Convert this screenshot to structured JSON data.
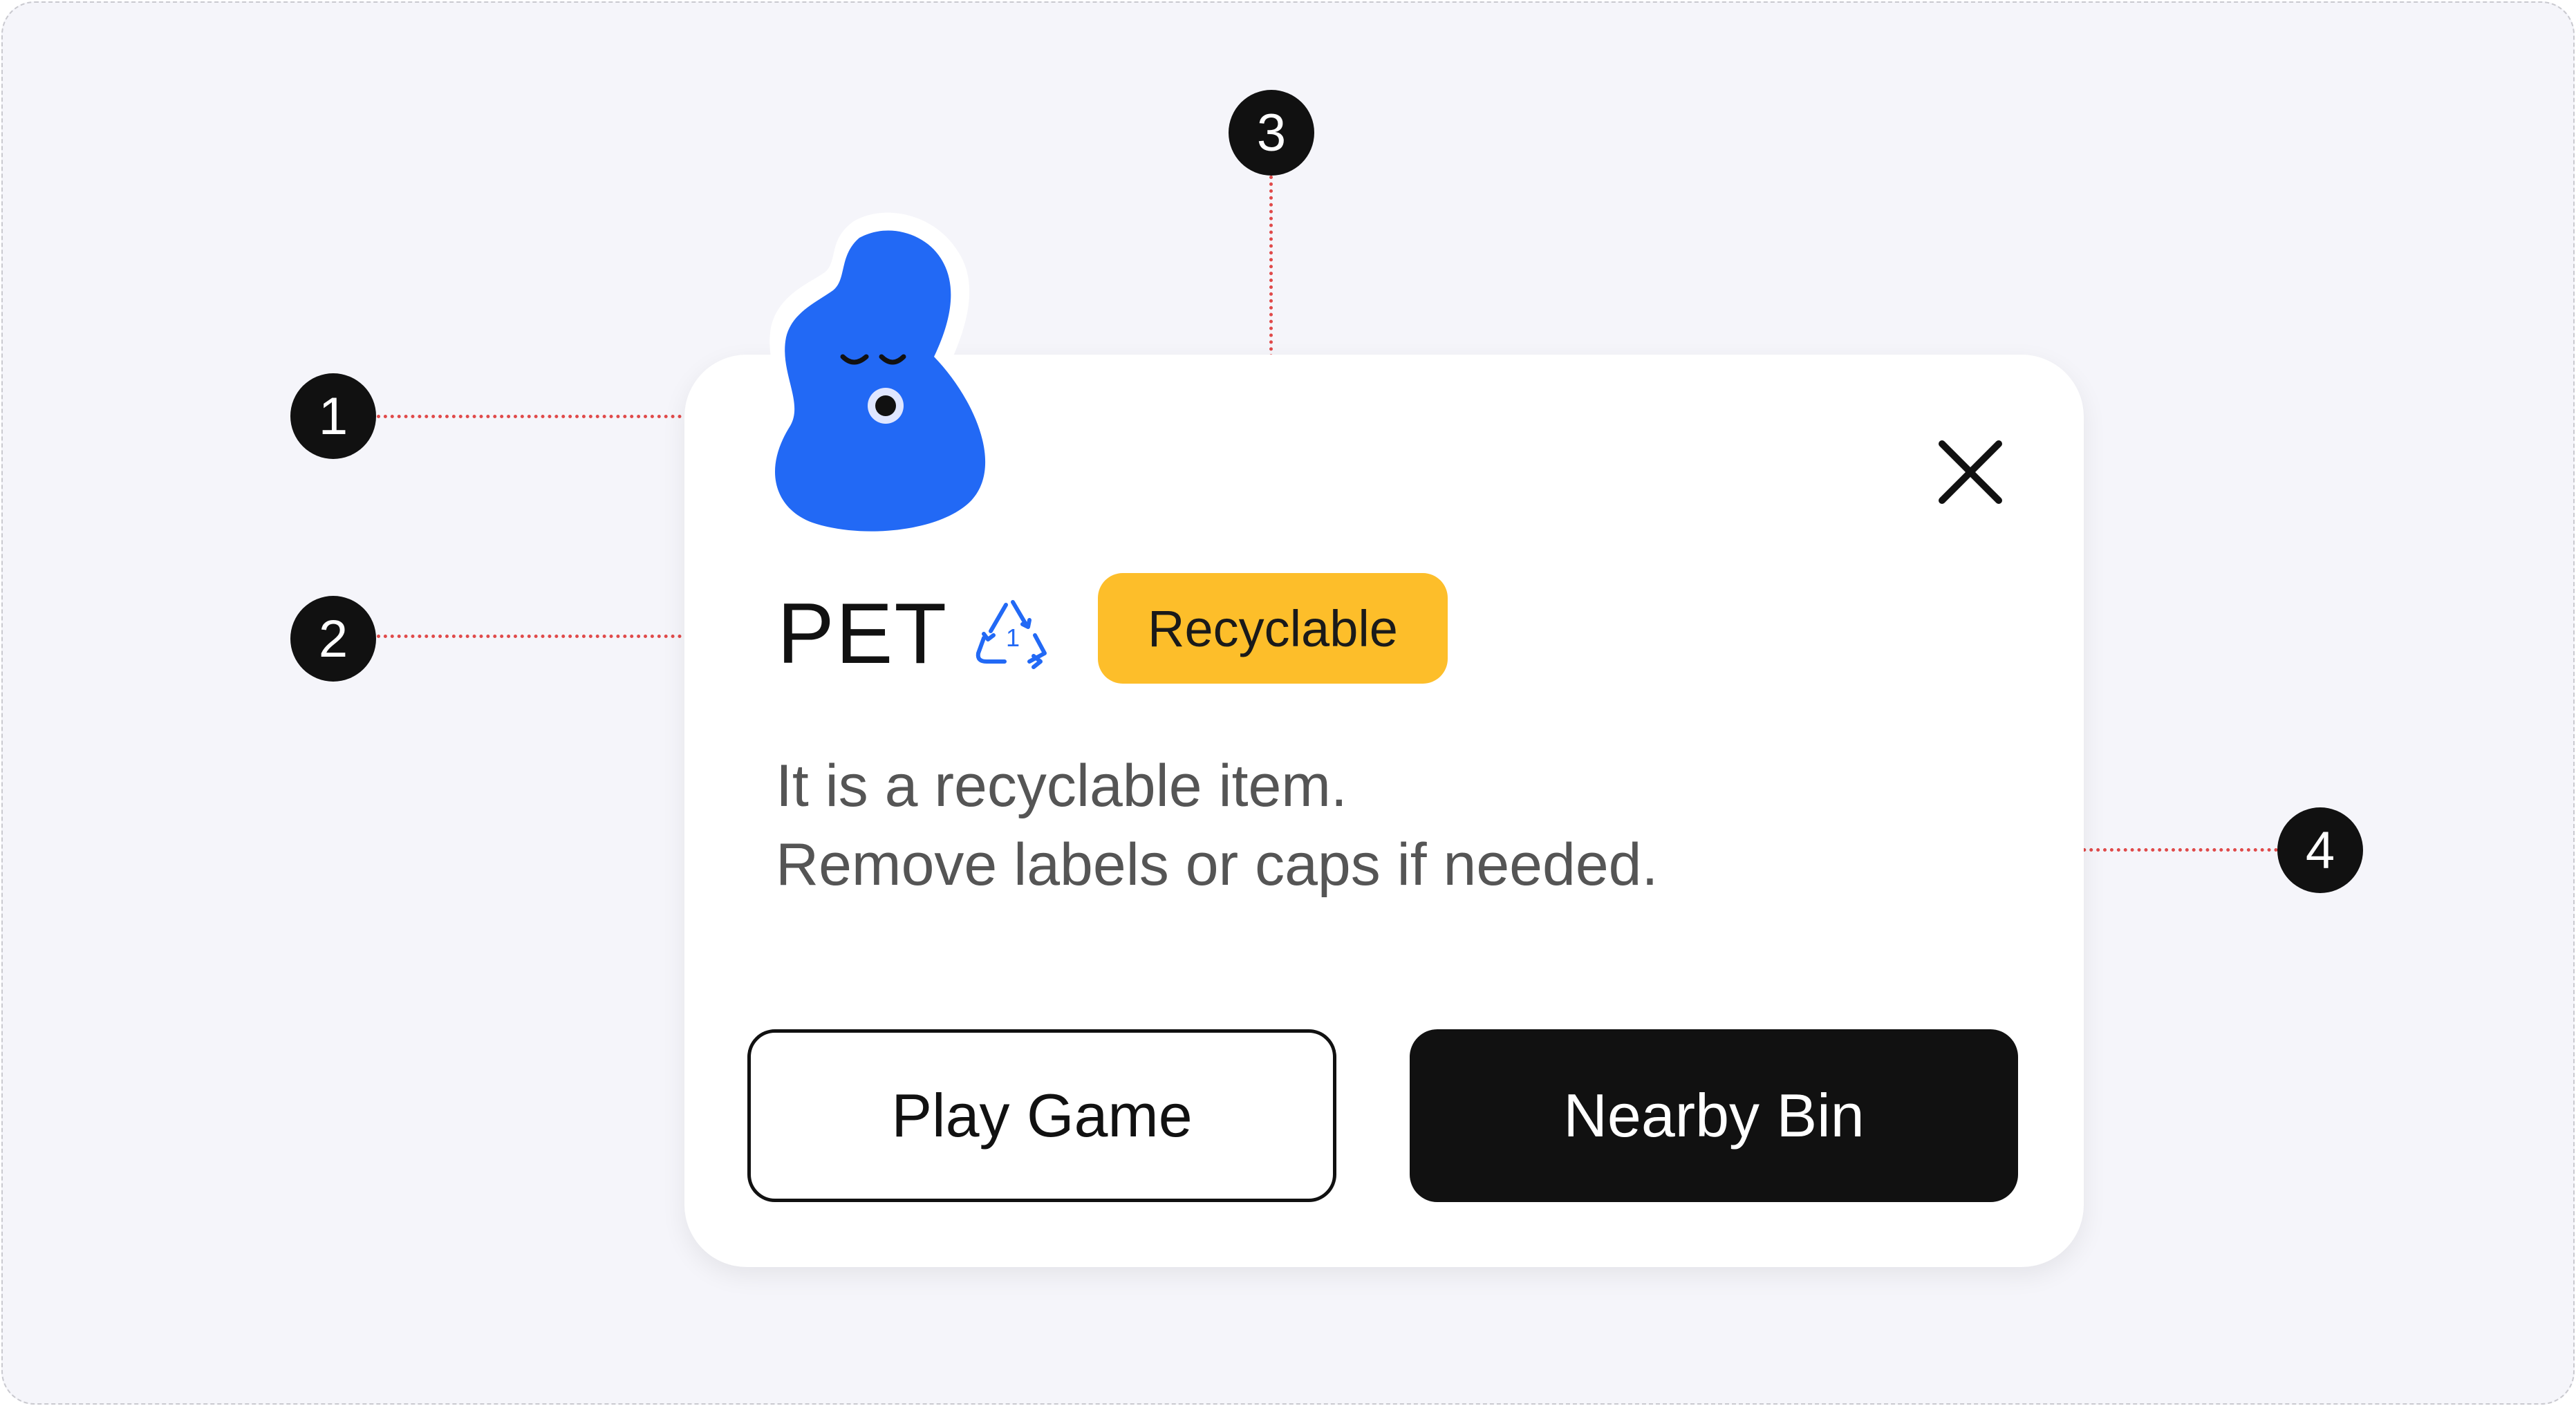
{
  "card": {
    "material": "PET",
    "recycle_symbol_number": "1",
    "badge": "Recyclable",
    "description": {
      "line1": "It is a recyclable item.",
      "line2": "Remove labels or caps if needed."
    },
    "primary_button": "Nearby Bin",
    "secondary_button": "Play Game"
  },
  "annotations": {
    "marker1": "1",
    "marker2": "2",
    "marker3": "3",
    "marker4": "4"
  },
  "icons": {
    "mascot": "blue-blob-character",
    "recycle": "recycle-triangle-icon",
    "close": "close-icon"
  },
  "colors": {
    "mascot_blue": "#2269f5",
    "badge_yellow": "#fdbe2a",
    "primary_button": "#111111",
    "recycle_icon": "#2269f5",
    "annotation_line": "#e04a4a",
    "background": "#f5f5fa"
  }
}
